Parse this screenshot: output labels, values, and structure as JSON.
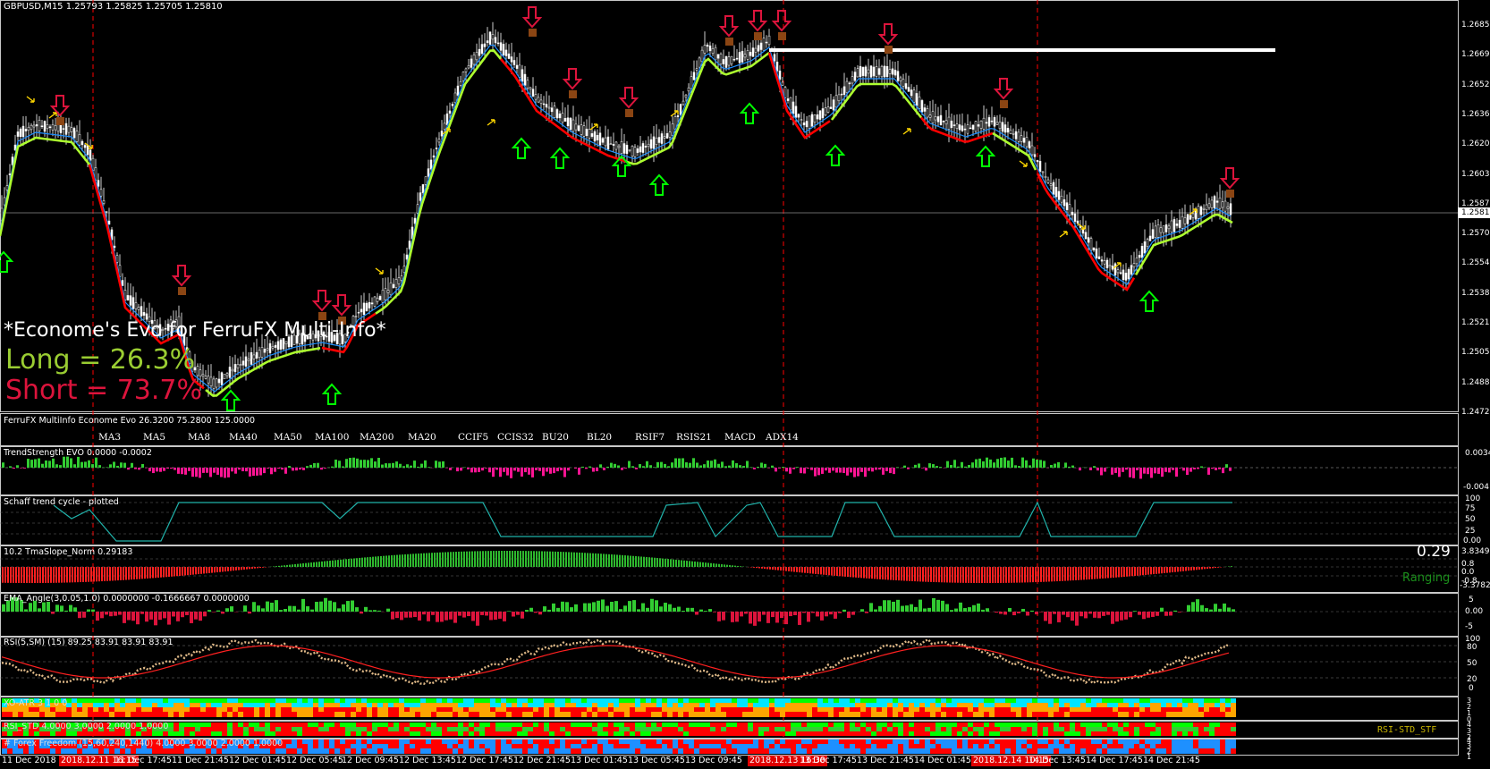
{
  "header": {
    "symbol_line": "GBPUSD,M15  1.25793 1.25825 1.25705 1.25810"
  },
  "overlay": {
    "evo_title": "*Econome's Evo for FerruFX Multi-Info*",
    "long_text": "Long = 26.3%",
    "short_text": "Short = 73.7%"
  },
  "price_axis": {
    "labels": [
      "1.26855",
      "1.26690",
      "1.26525",
      "1.26360",
      "1.26200",
      "1.26035",
      "1.25870",
      "1.25705",
      "1.25540",
      "1.25380",
      "1.25215",
      "1.25050",
      "1.24885",
      "1.24720"
    ],
    "current_price": "1.25810"
  },
  "panes": {
    "multiinfo": {
      "title": "FerruFX MultiInfo Econome Evo 26.3200 75.2800 125.0000",
      "items": [
        "MA3",
        "MA5",
        "MA8",
        "MA40",
        "MA50",
        "MA100",
        "MA200",
        "MA20",
        "CCIF5",
        "CCIS32",
        "BU20",
        "BL20",
        "RSIF7",
        "RSIS21",
        "MACD",
        "ADX14"
      ]
    },
    "trend_strength": {
      "title": "TrendStrength EVO 0.0000 -0.0002",
      "axis": [
        "0.0034",
        "-0.0041"
      ]
    },
    "schaff": {
      "title": "Schaff trend cycle - plotted",
      "axis": [
        "100",
        "75",
        "50",
        "25",
        "0.00"
      ]
    },
    "tmaslope": {
      "title": "10.2 TmaSlope_Norm 0.29183",
      "value_text": "0.29",
      "status_text": "Ranging",
      "axis": [
        "3.83499",
        "0.8",
        "0.0",
        "-0.8",
        "-3.37821"
      ]
    },
    "ema_angle": {
      "title": "EMA_Angle(3,0.05,1.0) 0.0000000 -0.1666667 0.0000000",
      "axis": [
        "5",
        "0.00",
        "-5"
      ]
    },
    "rsi": {
      "title": "RSI(5,SM) (15) 89.25 83.91 83.91 83.91",
      "axis": [
        "100",
        "80",
        "50",
        "20",
        "0"
      ]
    },
    "xo": {
      "title": "XO-ATR 3 1 0 0",
      "axis": [
        "3",
        "2",
        "1",
        "0"
      ]
    },
    "rsistd": {
      "title": "RSI_STD 4.0000 3.0000 2.0000 1.0000",
      "label": "RSI-STD_STF",
      "axis": [
        "4",
        "3",
        "2"
      ]
    },
    "freedom": {
      "title": "# Forex Freedom (15,60,240,1440) 4.0000 3.0000 2.0000 1.0000",
      "axis": [
        "4",
        "3",
        "2",
        "1"
      ]
    }
  },
  "time_axis": [
    {
      "t": "11 Dec 2018",
      "hl": false
    },
    {
      "t": "2018.12.11 16:15",
      "hl": true
    },
    {
      "t": "11 Dec 17:45",
      "hl": false
    },
    {
      "t": "11 Dec 21:45",
      "hl": false
    },
    {
      "t": "12 Dec 01:45",
      "hl": false
    },
    {
      "t": "12 Dec 05:45",
      "hl": false
    },
    {
      "t": "12 Dec 09:45",
      "hl": false
    },
    {
      "t": "12 Dec 13:45",
      "hl": false
    },
    {
      "t": "12 Dec 17:45",
      "hl": false
    },
    {
      "t": "12 Dec 21:45",
      "hl": false
    },
    {
      "t": "13 Dec 01:45",
      "hl": false
    },
    {
      "t": "13 Dec 05:45",
      "hl": false
    },
    {
      "t": "13 Dec 09:45",
      "hl": false
    },
    {
      "t": "2018.12.13 16:30",
      "hl": true
    },
    {
      "t": "13 Dec 17:45",
      "hl": false
    },
    {
      "t": "13 Dec 21:45",
      "hl": false
    },
    {
      "t": "14 Dec 01:45",
      "hl": false
    },
    {
      "t": "2018.12.14 10:15",
      "hl": true
    },
    {
      "t": "14 Dec 13:45",
      "hl": false
    },
    {
      "t": "14 Dec 17:45",
      "hl": false
    },
    {
      "t": "14 Dec 21:45",
      "hl": false
    }
  ],
  "colors": {
    "background": "#000000",
    "bull_ma": "#ADFF2F",
    "bear_ma": "#FF0000",
    "fast_ma": "#1E90FF",
    "up_arrow": "#00FF00",
    "down_arrow": "#DC143C",
    "separator": "#FF0000",
    "level_line": "#FFFFFF"
  }
}
